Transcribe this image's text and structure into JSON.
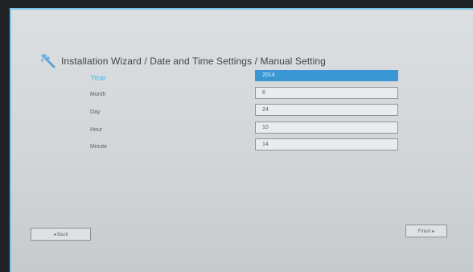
{
  "wizard": {
    "title": "Installation Wizard / Date and Time Settings / Manual Setting"
  },
  "fields": [
    {
      "label": "Year",
      "value": "2014"
    },
    {
      "label": "Month",
      "value": "6"
    },
    {
      "label": "Day",
      "value": "24"
    },
    {
      "label": "Hour",
      "value": "10"
    },
    {
      "label": "Minute",
      "value": "14"
    }
  ],
  "nav": {
    "back_label": "◂ Back",
    "finish_label": "Finish ▸"
  },
  "colors": {
    "accent": "#3b97d3",
    "active_label": "#58b9ea",
    "frame": "#7ec3e6"
  },
  "icons": {
    "wizard": "wand-icon"
  }
}
